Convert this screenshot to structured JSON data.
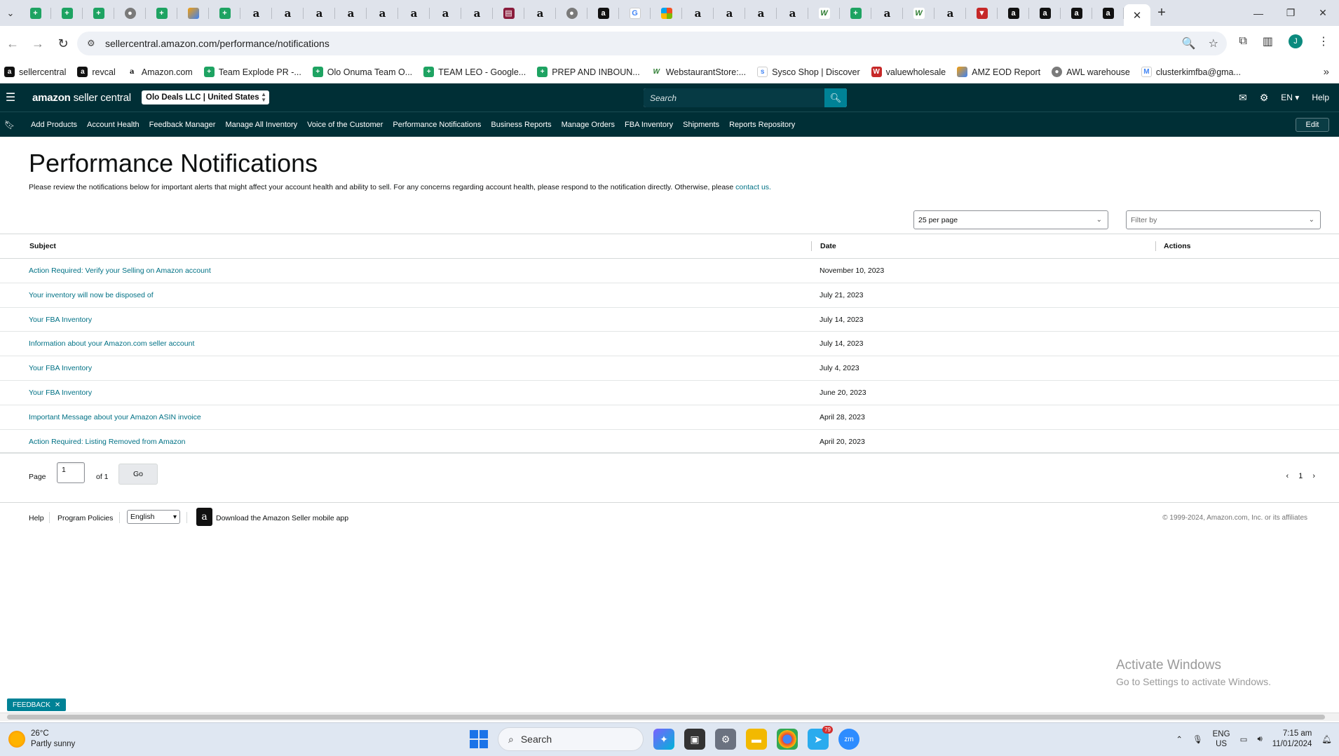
{
  "browser": {
    "tabs": [
      {
        "icon": "sheets-icon"
      },
      {
        "icon": "sheets-icon"
      },
      {
        "icon": "sheets-icon"
      },
      {
        "icon": "globe-icon"
      },
      {
        "icon": "sheets-icon"
      },
      {
        "icon": "zapier-icon"
      },
      {
        "icon": "sheets-icon"
      },
      {
        "icon": "amazon-icon"
      },
      {
        "icon": "amazon-icon"
      },
      {
        "icon": "amazon-icon"
      },
      {
        "icon": "amazon-icon"
      },
      {
        "icon": "amazon-icon"
      },
      {
        "icon": "amazon-icon"
      },
      {
        "icon": "amazon-icon"
      },
      {
        "icon": "amazon-icon"
      },
      {
        "icon": "report-icon"
      },
      {
        "icon": "amazon-icon"
      },
      {
        "icon": "globe-icon"
      },
      {
        "icon": "amazon-box-icon"
      },
      {
        "icon": "google-icon"
      },
      {
        "icon": "ms-icon"
      },
      {
        "icon": "amazon-icon"
      },
      {
        "icon": "amazon-icon"
      },
      {
        "icon": "amazon-icon"
      },
      {
        "icon": "amazon-icon"
      },
      {
        "icon": "webstaurant-icon"
      },
      {
        "icon": "sheets-icon"
      },
      {
        "icon": "amazon-icon"
      },
      {
        "icon": "webstaurant-icon"
      },
      {
        "icon": "amazon-icon"
      },
      {
        "icon": "red-icon"
      },
      {
        "icon": "amazon-box-icon"
      },
      {
        "icon": "amazon-box-icon"
      },
      {
        "icon": "amazon-box-icon"
      },
      {
        "icon": "amazon-box-icon"
      }
    ],
    "active_tab_icon": "close-icon",
    "url": "sellercentral.amazon.com/performance/notifications",
    "bookmarks": [
      {
        "label": "sellercentral",
        "icon": "amazon-box-icon"
      },
      {
        "label": "revcal",
        "icon": "amazon-box-icon"
      },
      {
        "label": "Amazon.com",
        "icon": "amazon-icon"
      },
      {
        "label": "Team Explode PR -...",
        "icon": "sheets-icon"
      },
      {
        "label": "Olo Onuma Team O...",
        "icon": "sheets-icon"
      },
      {
        "label": "TEAM LEO - Google...",
        "icon": "sheets-icon"
      },
      {
        "label": "PREP AND INBOUN...",
        "icon": "sheets-icon"
      },
      {
        "label": "WebstaurantStore:...",
        "icon": "webstaurant-icon"
      },
      {
        "label": "Sysco Shop | Discover",
        "icon": "sysco-icon"
      },
      {
        "label": "valuewholesale",
        "icon": "vw-icon"
      },
      {
        "label": "AMZ EOD Report",
        "icon": "zapier-icon"
      },
      {
        "label": "AWL warehouse",
        "icon": "globe-icon"
      },
      {
        "label": "clusterkimfba@gma...",
        "icon": "gmail-icon"
      }
    ],
    "avatar_letter": "J"
  },
  "header": {
    "logo_bold": "amazon",
    "logo_rest": " seller central",
    "account": "Olo Deals LLC | United States",
    "search_placeholder": "Search",
    "lang": "EN",
    "help": "Help"
  },
  "nav": {
    "items": [
      "Add Products",
      "Account Health",
      "Feedback Manager",
      "Manage All Inventory",
      "Voice of the Customer",
      "Performance Notifications",
      "Business Reports",
      "Manage Orders",
      "FBA Inventory",
      "Shipments",
      "Reports Repository"
    ],
    "edit": "Edit"
  },
  "main": {
    "title": "Performance Notifications",
    "description": "Please review the notifications below for important alerts that might affect your account health and ability to sell. For any concerns regarding account health, please respond to the notification directly. Otherwise, please ",
    "contact_link": "contact us.",
    "per_page": "25 per page",
    "filter_placeholder": "Filter by",
    "columns": {
      "subject": "Subject",
      "date": "Date",
      "actions": "Actions"
    },
    "rows": [
      {
        "subject": "Action Required: Verify your Selling on Amazon account",
        "date": "November 10, 2023"
      },
      {
        "subject": "Your inventory will now be disposed of",
        "date": "July 21, 2023"
      },
      {
        "subject": "Your FBA Inventory",
        "date": "July 14, 2023"
      },
      {
        "subject": "Information about your Amazon.com seller account",
        "date": "July 14, 2023"
      },
      {
        "subject": "Your FBA Inventory",
        "date": "July 4, 2023"
      },
      {
        "subject": "Your FBA Inventory",
        "date": "June 20, 2023"
      },
      {
        "subject": "Important Message about your Amazon ASIN invoice",
        "date": "April 28, 2023"
      },
      {
        "subject": "Action Required: Listing Removed from Amazon",
        "date": "April 20, 2023"
      }
    ],
    "pager": {
      "label": "Page",
      "value": "1",
      "of": "of 1",
      "go": "Go",
      "current": "1"
    }
  },
  "footer": {
    "help": "Help",
    "policies": "Program Policies",
    "language": "English",
    "app": "Download the Amazon Seller mobile app",
    "copyright": "© 1999-2024, Amazon.com, Inc. or its affiliates"
  },
  "watermark": {
    "line1": "Activate Windows",
    "line2": "Go to Settings to activate Windows."
  },
  "feedback": "FEEDBACK",
  "taskbar": {
    "temp": "26°C",
    "weather": "Partly sunny",
    "search": "Search",
    "telegram_badge": "79",
    "lang1": "ENG",
    "lang2": "US",
    "time": "7:15 am",
    "date": "11/01/2024"
  }
}
